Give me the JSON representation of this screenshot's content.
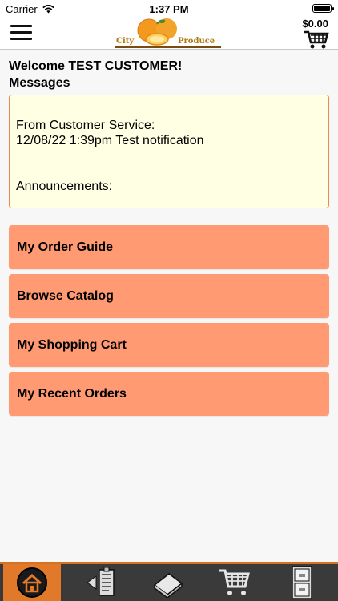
{
  "status_bar": {
    "carrier": "Carrier",
    "time": "1:37 PM"
  },
  "header": {
    "logo_word_left": "City",
    "logo_word_right": "Produce",
    "cart_total": "$0.00"
  },
  "welcome_text": "Welcome TEST CUSTOMER!",
  "messages": {
    "heading": "Messages",
    "from_line": "From Customer Service:",
    "notification": "12/08/22 1:39pm Test notification",
    "announcements_label": "Announcements:"
  },
  "menu": {
    "order_guide": "My Order Guide",
    "browse_catalog": "Browse Catalog",
    "shopping_cart": "My Shopping Cart",
    "recent_orders": "My Recent Orders"
  },
  "colors": {
    "accent": "#ff9a72",
    "message_bg": "#ffffe3",
    "tab_bar": "#3a3a3a",
    "tab_active": "#e07a2a"
  },
  "tab_icons": [
    "home-icon",
    "order-guide-icon",
    "catalog-book-icon",
    "shopping-cart-icon",
    "recent-orders-cabinet-icon"
  ]
}
